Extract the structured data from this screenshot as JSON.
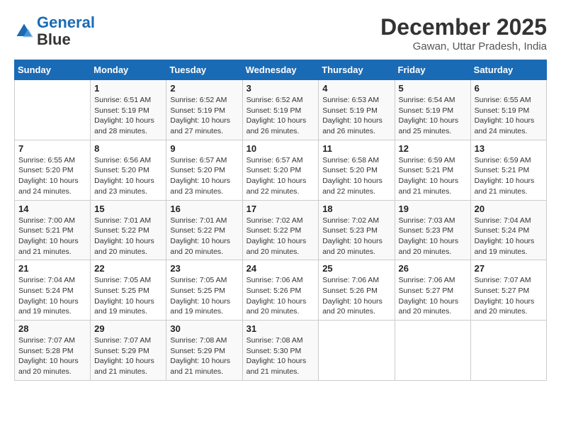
{
  "header": {
    "logo_line1": "General",
    "logo_line2": "Blue",
    "month": "December 2025",
    "location": "Gawan, Uttar Pradesh, India"
  },
  "days_of_week": [
    "Sunday",
    "Monday",
    "Tuesday",
    "Wednesday",
    "Thursday",
    "Friday",
    "Saturday"
  ],
  "weeks": [
    [
      {
        "day": "",
        "info": ""
      },
      {
        "day": "1",
        "info": "Sunrise: 6:51 AM\nSunset: 5:19 PM\nDaylight: 10 hours\nand 28 minutes."
      },
      {
        "day": "2",
        "info": "Sunrise: 6:52 AM\nSunset: 5:19 PM\nDaylight: 10 hours\nand 27 minutes."
      },
      {
        "day": "3",
        "info": "Sunrise: 6:52 AM\nSunset: 5:19 PM\nDaylight: 10 hours\nand 26 minutes."
      },
      {
        "day": "4",
        "info": "Sunrise: 6:53 AM\nSunset: 5:19 PM\nDaylight: 10 hours\nand 26 minutes."
      },
      {
        "day": "5",
        "info": "Sunrise: 6:54 AM\nSunset: 5:19 PM\nDaylight: 10 hours\nand 25 minutes."
      },
      {
        "day": "6",
        "info": "Sunrise: 6:55 AM\nSunset: 5:19 PM\nDaylight: 10 hours\nand 24 minutes."
      }
    ],
    [
      {
        "day": "7",
        "info": "Sunrise: 6:55 AM\nSunset: 5:20 PM\nDaylight: 10 hours\nand 24 minutes."
      },
      {
        "day": "8",
        "info": "Sunrise: 6:56 AM\nSunset: 5:20 PM\nDaylight: 10 hours\nand 23 minutes."
      },
      {
        "day": "9",
        "info": "Sunrise: 6:57 AM\nSunset: 5:20 PM\nDaylight: 10 hours\nand 23 minutes."
      },
      {
        "day": "10",
        "info": "Sunrise: 6:57 AM\nSunset: 5:20 PM\nDaylight: 10 hours\nand 22 minutes."
      },
      {
        "day": "11",
        "info": "Sunrise: 6:58 AM\nSunset: 5:20 PM\nDaylight: 10 hours\nand 22 minutes."
      },
      {
        "day": "12",
        "info": "Sunrise: 6:59 AM\nSunset: 5:21 PM\nDaylight: 10 hours\nand 21 minutes."
      },
      {
        "day": "13",
        "info": "Sunrise: 6:59 AM\nSunset: 5:21 PM\nDaylight: 10 hours\nand 21 minutes."
      }
    ],
    [
      {
        "day": "14",
        "info": "Sunrise: 7:00 AM\nSunset: 5:21 PM\nDaylight: 10 hours\nand 21 minutes."
      },
      {
        "day": "15",
        "info": "Sunrise: 7:01 AM\nSunset: 5:22 PM\nDaylight: 10 hours\nand 20 minutes."
      },
      {
        "day": "16",
        "info": "Sunrise: 7:01 AM\nSunset: 5:22 PM\nDaylight: 10 hours\nand 20 minutes."
      },
      {
        "day": "17",
        "info": "Sunrise: 7:02 AM\nSunset: 5:22 PM\nDaylight: 10 hours\nand 20 minutes."
      },
      {
        "day": "18",
        "info": "Sunrise: 7:02 AM\nSunset: 5:23 PM\nDaylight: 10 hours\nand 20 minutes."
      },
      {
        "day": "19",
        "info": "Sunrise: 7:03 AM\nSunset: 5:23 PM\nDaylight: 10 hours\nand 20 minutes."
      },
      {
        "day": "20",
        "info": "Sunrise: 7:04 AM\nSunset: 5:24 PM\nDaylight: 10 hours\nand 19 minutes."
      }
    ],
    [
      {
        "day": "21",
        "info": "Sunrise: 7:04 AM\nSunset: 5:24 PM\nDaylight: 10 hours\nand 19 minutes."
      },
      {
        "day": "22",
        "info": "Sunrise: 7:05 AM\nSunset: 5:25 PM\nDaylight: 10 hours\nand 19 minutes."
      },
      {
        "day": "23",
        "info": "Sunrise: 7:05 AM\nSunset: 5:25 PM\nDaylight: 10 hours\nand 19 minutes."
      },
      {
        "day": "24",
        "info": "Sunrise: 7:06 AM\nSunset: 5:26 PM\nDaylight: 10 hours\nand 20 minutes."
      },
      {
        "day": "25",
        "info": "Sunrise: 7:06 AM\nSunset: 5:26 PM\nDaylight: 10 hours\nand 20 minutes."
      },
      {
        "day": "26",
        "info": "Sunrise: 7:06 AM\nSunset: 5:27 PM\nDaylight: 10 hours\nand 20 minutes."
      },
      {
        "day": "27",
        "info": "Sunrise: 7:07 AM\nSunset: 5:27 PM\nDaylight: 10 hours\nand 20 minutes."
      }
    ],
    [
      {
        "day": "28",
        "info": "Sunrise: 7:07 AM\nSunset: 5:28 PM\nDaylight: 10 hours\nand 20 minutes."
      },
      {
        "day": "29",
        "info": "Sunrise: 7:07 AM\nSunset: 5:29 PM\nDaylight: 10 hours\nand 21 minutes."
      },
      {
        "day": "30",
        "info": "Sunrise: 7:08 AM\nSunset: 5:29 PM\nDaylight: 10 hours\nand 21 minutes."
      },
      {
        "day": "31",
        "info": "Sunrise: 7:08 AM\nSunset: 5:30 PM\nDaylight: 10 hours\nand 21 minutes."
      },
      {
        "day": "",
        "info": ""
      },
      {
        "day": "",
        "info": ""
      },
      {
        "day": "",
        "info": ""
      }
    ]
  ]
}
